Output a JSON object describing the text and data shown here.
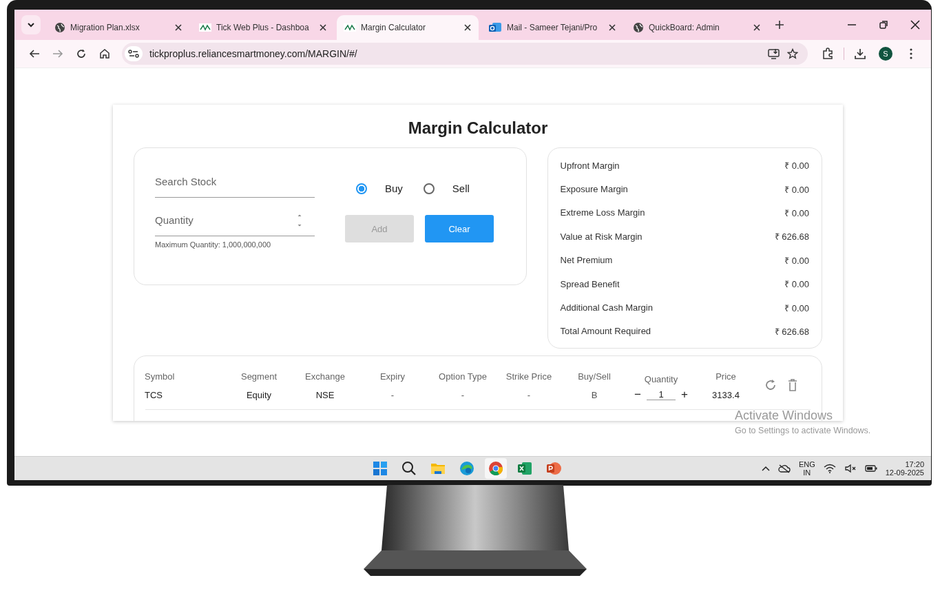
{
  "browser": {
    "tabs": [
      {
        "title": "Migration Plan.xlsx",
        "kind": "globe",
        "selected": false
      },
      {
        "title": "Tick Web Plus - Dashboa",
        "kind": "tick",
        "selected": false
      },
      {
        "title": "Margin Calculator",
        "kind": "tick",
        "selected": true
      },
      {
        "title": "Mail - Sameer Tejani/Pro",
        "kind": "mail",
        "selected": false
      },
      {
        "title": "QuickBoard: Admin",
        "kind": "globe",
        "selected": false
      }
    ],
    "url": "tickproplus.reliancesmartmoney.com/MARGIN/#/",
    "profile_initial": "S"
  },
  "page": {
    "title": "Margin Calculator",
    "form": {
      "search_placeholder": "Search Stock",
      "quantity_placeholder": "Quantity",
      "quantity_hint": "Maximum Quantity: 1,000,000,000",
      "sides": [
        {
          "label": "Buy",
          "selected": true
        },
        {
          "label": "Sell",
          "selected": false
        }
      ],
      "buttons": [
        {
          "label": "Add",
          "disabled": true
        },
        {
          "label": "Clear",
          "disabled": false
        }
      ]
    },
    "summary": [
      {
        "label": "Upfront Margin",
        "value": "₹ 0.00"
      },
      {
        "label": "Exposure Margin",
        "value": "₹ 0.00"
      },
      {
        "label": "Extreme Loss Margin",
        "value": "₹ 0.00"
      },
      {
        "label": "Value at Risk Margin",
        "value": "₹ 626.68"
      },
      {
        "label": "Net Premium",
        "value": "₹ 0.00"
      },
      {
        "label": "Spread Benefit",
        "value": "₹ 0.00"
      },
      {
        "label": "Additional Cash Margin",
        "value": "₹ 0.00"
      },
      {
        "label": "Total Amount Required",
        "value": "₹ 626.68"
      }
    ],
    "positions": {
      "columns": [
        "Symbol",
        "Segment",
        "Exchange",
        "Expiry",
        "Option Type",
        "Strike Price",
        "Buy/Sell",
        "Quantity",
        "Price"
      ],
      "rows": [
        {
          "symbol": "TCS",
          "segment": "Equity",
          "exchange": "NSE",
          "expiry": "-",
          "option_type": "-",
          "strike_price": "-",
          "side": "B",
          "quantity": "1",
          "price": "3133.4",
          "decrement": "−",
          "increment": "+"
        }
      ]
    }
  },
  "activation": {
    "title": "Activate Windows",
    "message": "Go to Settings to activate Windows."
  },
  "taskbar": {
    "apps": [
      {
        "kind": "start",
        "selected": false
      },
      {
        "kind": "search",
        "selected": false
      },
      {
        "kind": "folder",
        "selected": false
      },
      {
        "kind": "edge",
        "selected": false
      },
      {
        "kind": "chrome",
        "selected": true
      },
      {
        "kind": "excel",
        "selected": false
      },
      {
        "kind": "powerpoint",
        "selected": false
      }
    ],
    "language": "ENG",
    "region": "IN",
    "time": "17:20",
    "date": "12-09-2025"
  }
}
